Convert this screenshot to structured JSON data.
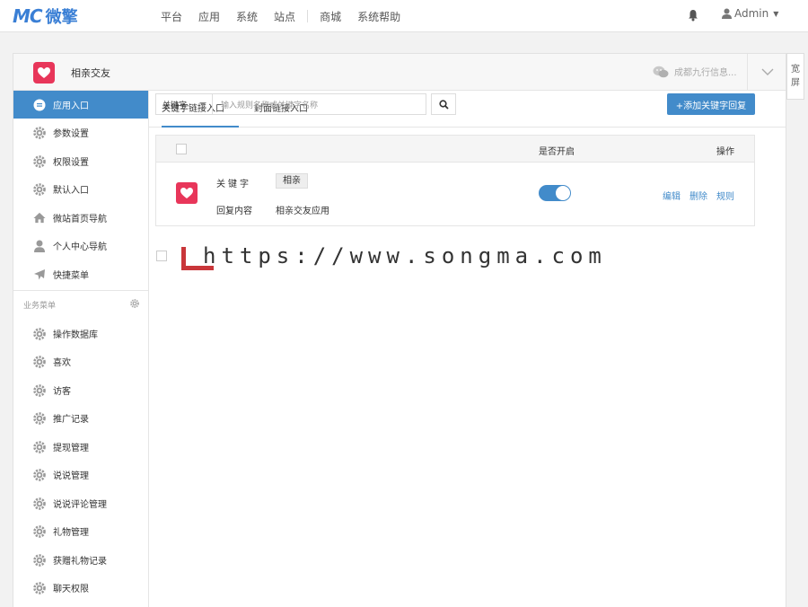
{
  "brand": {
    "logo_mark": "MC",
    "logo_text": "微擎"
  },
  "nav": {
    "items": [
      "平台",
      "应用",
      "系统",
      "站点",
      "商城",
      "系统帮助"
    ]
  },
  "user": {
    "name": "Admin"
  },
  "app": {
    "name": "相亲交友",
    "account": "成都九行信息..."
  },
  "wide_toggle": [
    "宽",
    "屏"
  ],
  "sidebar": {
    "items": [
      {
        "label": "应用入口",
        "icon": "comment-icon",
        "active": true
      },
      {
        "label": "参数设置",
        "icon": "gear-icon"
      },
      {
        "label": "权限设置",
        "icon": "gear-icon"
      },
      {
        "label": "默认入口",
        "icon": "gear-icon"
      },
      {
        "label": "微站首页导航",
        "icon": "home-icon"
      },
      {
        "label": "个人中心导航",
        "icon": "user-icon"
      },
      {
        "label": "快捷菜单",
        "icon": "plane-icon"
      }
    ],
    "group_title": "业务菜单",
    "group_items": [
      "操作数据库",
      "喜欢",
      "访客",
      "推广记录",
      "提现管理",
      "说说管理",
      "说说评论管理",
      "礼物管理",
      "获赠礼物记录",
      "聊天权限"
    ]
  },
  "tabs": [
    "关键字链接入口",
    "封面链接入口"
  ],
  "filter": {
    "select": "关键字",
    "placeholder": "输入规则名称或关键字名称",
    "add_button": "+添加关键字回复"
  },
  "table": {
    "headers": {
      "enabled": "是否开启",
      "ops": "操作"
    },
    "row": {
      "keyword_label": "关键字",
      "keyword": "相亲",
      "reply_label": "回复内容",
      "reply": "相亲交友应用",
      "enabled": true,
      "ops": [
        "编辑",
        "删除",
        "规则"
      ]
    }
  },
  "watermark": "https://www.songma.com",
  "colors": {
    "primary": "#428bca",
    "app_icon": "#e8365a",
    "watermark_mark": "#c9363a"
  }
}
